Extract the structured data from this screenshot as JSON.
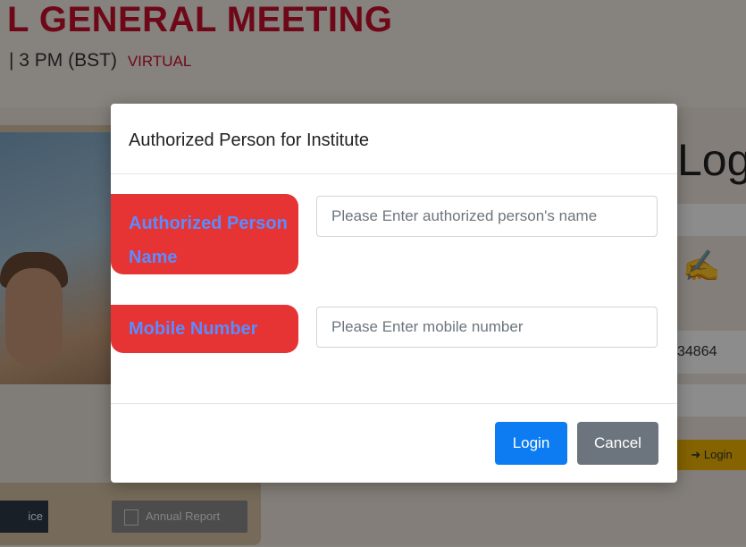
{
  "background": {
    "event_title": "L GENERAL MEETING",
    "event_time": "| 3 PM (BST)",
    "event_mode": "VIRTUAL",
    "login_heading": "Log",
    "account_number_fragment": "34864",
    "login_button": "Login",
    "notice_button": "ice",
    "annual_report_button": "Annual Report"
  },
  "modal": {
    "title": "Authorized Person for Institute",
    "fields": {
      "name": {
        "label": "Authorized Person Name",
        "value": "",
        "placeholder": "Please Enter authorized person's name"
      },
      "mobile": {
        "label": "Mobile Number",
        "value": "",
        "placeholder": "Please Enter mobile number"
      }
    },
    "buttons": {
      "login": "Login",
      "cancel": "Cancel"
    }
  },
  "colors": {
    "accent_blue": "#0d7cf2",
    "cancel_gray": "#6c757d",
    "label_red": "#e63333",
    "brand_red": "#c8102e"
  }
}
